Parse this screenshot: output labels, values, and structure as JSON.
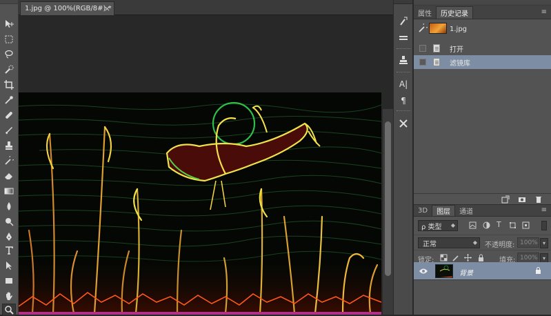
{
  "document": {
    "tab_title": "1.jpg @ 100%(RGB/8#) *",
    "close_glyph": "×"
  },
  "tools": [
    "move-tool-icon",
    "rect-marquee-icon",
    "lasso-icon",
    "quick-select-icon",
    "crop-icon",
    "eyedropper-icon",
    "healing-brush-icon",
    "brush-icon",
    "clone-stamp-icon",
    "history-brush-icon",
    "eraser-icon",
    "gradient-icon",
    "blur-icon",
    "dodge-icon",
    "pen-icon",
    "type-icon",
    "path-select-icon",
    "rectangle-shape-icon",
    "hand-icon",
    "zoom-icon"
  ],
  "dock": {
    "char_label": "A|",
    "para_label": "¶"
  },
  "history_panel": {
    "tabs": [
      {
        "label": "属性",
        "active": false
      },
      {
        "label": "历史记录",
        "active": true
      }
    ],
    "snapshot_label": "1.jpg",
    "states": [
      {
        "label": "打开",
        "selected": false
      },
      {
        "label": "滤镜库",
        "selected": true
      }
    ]
  },
  "layers_panel": {
    "tabs": [
      {
        "label": "3D",
        "active": false
      },
      {
        "label": "图层",
        "active": true
      },
      {
        "label": "通道",
        "active": false
      }
    ],
    "kind_filter": "ρ 类型",
    "blend_mode": "正常",
    "opacity_label": "不透明度:",
    "opacity_value": "100%",
    "lock_label": "锁定:",
    "fill_label": "填充:",
    "fill_value": "100%",
    "layer_name": "背景"
  },
  "colors": {
    "panel_bg": "#535353",
    "selection": "#7d8ea4",
    "canvas_bg": "#282828"
  }
}
